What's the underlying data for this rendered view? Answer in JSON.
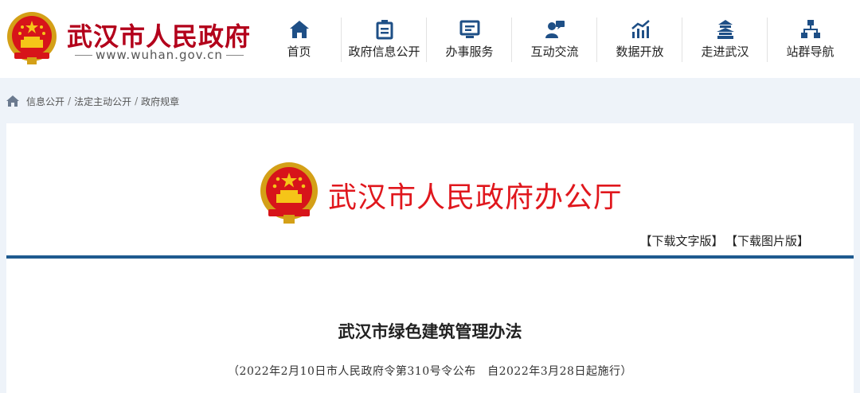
{
  "header": {
    "site_title": "武汉市人民政府",
    "site_domain": "www.wuhan.gov.cn",
    "brand_color": "#b3001b"
  },
  "nav": {
    "items": [
      {
        "label": "首页",
        "icon": "home-icon"
      },
      {
        "label": "政府信息公开",
        "icon": "document-icon"
      },
      {
        "label": "办事服务",
        "icon": "monitor-icon"
      },
      {
        "label": "互动交流",
        "icon": "chat-user-icon"
      },
      {
        "label": "数据开放",
        "icon": "chart-icon"
      },
      {
        "label": "走进武汉",
        "icon": "tower-icon"
      },
      {
        "label": "站群导航",
        "icon": "sitemap-icon"
      }
    ],
    "icon_color": "#1e4f86"
  },
  "breadcrumb": {
    "items": [
      "信息公开",
      "法定主动公开",
      "政府规章"
    ],
    "separator": "/"
  },
  "document": {
    "office_title": "武汉市人民政府办公厅",
    "office_color": "#e0171d",
    "download_text": "【下载文字版】",
    "download_image": "【下载图片版】",
    "rule_color": "#1e5a8f",
    "title": "武汉市绿色建筑管理办法",
    "subtitle": "（2022年2月10日市人民政府令第310号令公布　自2022年3月28日起施行）"
  }
}
